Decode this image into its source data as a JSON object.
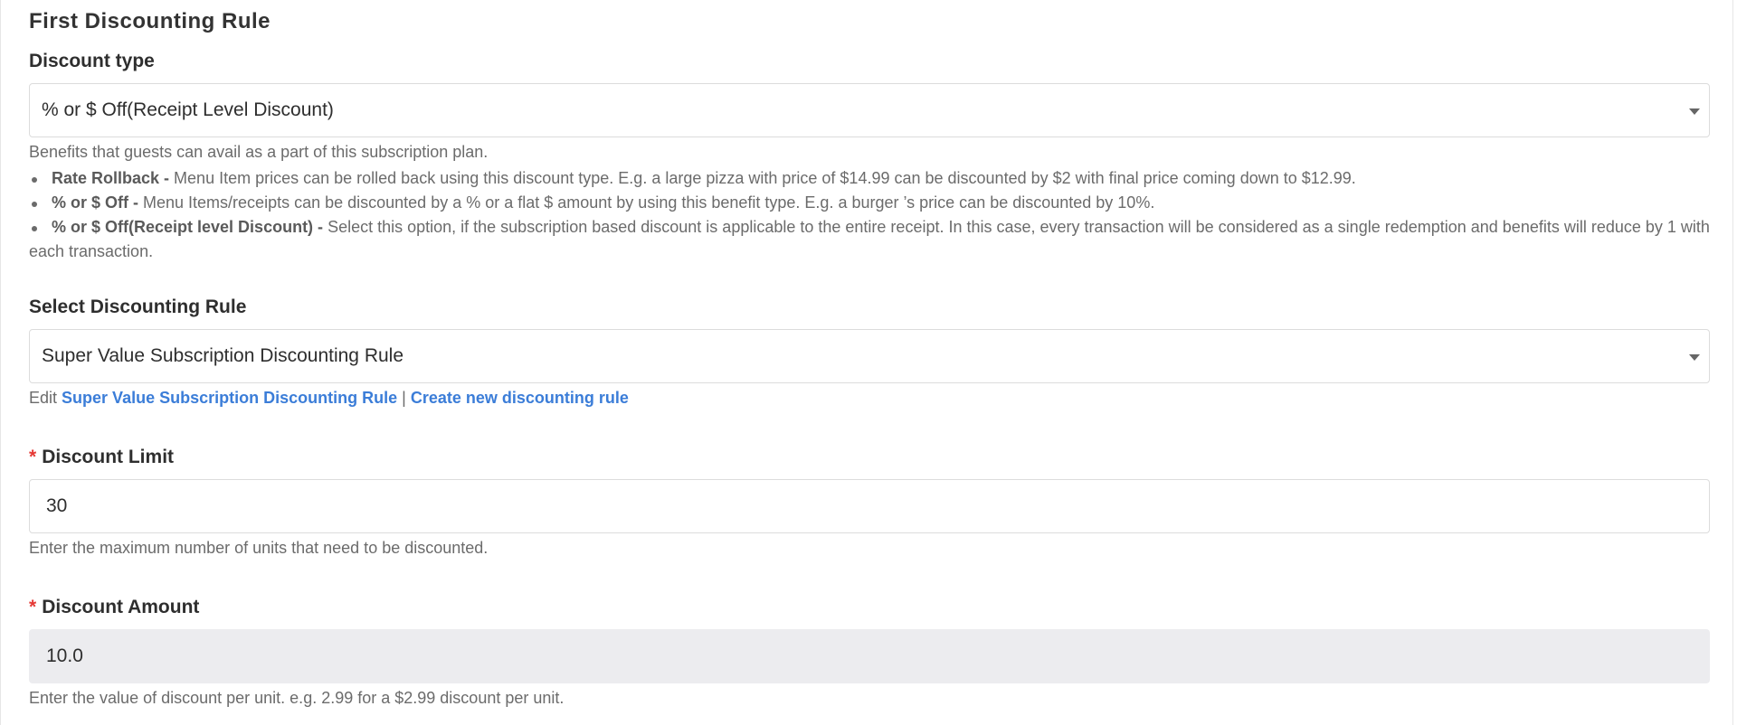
{
  "section": {
    "title": "First Discounting Rule"
  },
  "discount_type": {
    "label": "Discount type",
    "selected": "% or $ Off(Receipt Level Discount)",
    "icon": "chevron-down-icon",
    "help_intro": "Benefits that guests can avail as a part of this subscription plan.",
    "benefits": [
      {
        "term": "Rate Rollback -",
        "text": " Menu Item prices can be rolled back using this discount type. E.g. a large pizza with price of $14.99 can be discounted by $2 with final price coming down to $12.99."
      },
      {
        "term": "% or $ Off -",
        "text": " Menu Items/receipts can be discounted by a % or a flat $ amount by using this benefit type. E.g. a burger ’s price can be discounted by 10%."
      },
      {
        "term": "% or $ Off(Receipt level Discount) -",
        "text": " Select this option, if the subscription based discount is applicable to the entire receipt. In this case, every transaction will be considered as a single redemption and benefits will reduce by 1 with each transaction."
      }
    ]
  },
  "discounting_rule": {
    "label": "Select Discounting Rule",
    "selected": "Super Value Subscription Discounting Rule",
    "icon": "chevron-down-icon",
    "edit_prefix": "Edit",
    "edit_link": "Super Value Subscription Discounting Rule",
    "separator": "|",
    "create_link": "Create new discounting rule"
  },
  "discount_limit": {
    "required_mark": "*",
    "label": "Discount Limit",
    "value": "30",
    "help": "Enter the maximum number of units that need to be discounted."
  },
  "discount_amount": {
    "required_mark": "*",
    "label": "Discount Amount",
    "value": "10.0",
    "help": "Enter the value of discount per unit. e.g. 2.99 for a $2.99 discount per unit."
  },
  "colors": {
    "link": "#3b7dd8",
    "required": "#e53935",
    "disabled_bg": "#ececef",
    "help_text": "#6b6b6b"
  }
}
